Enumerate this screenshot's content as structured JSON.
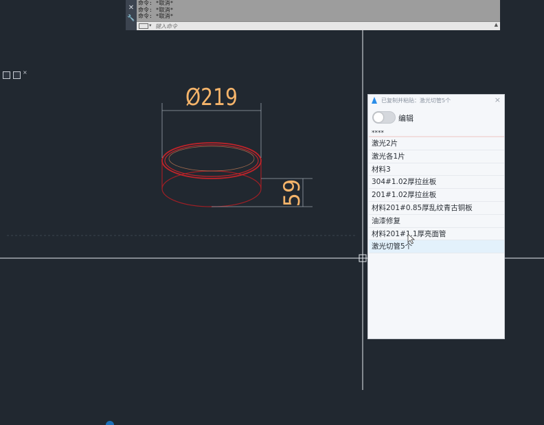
{
  "command_line": {
    "history": [
      "命令: *取消*",
      "命令: *取消*",
      "命令: *取消*"
    ],
    "input_placeholder": "键入命令",
    "side_buttons": [
      "✕",
      "🔧"
    ]
  },
  "drawing": {
    "diameter_label": "Ø219",
    "height_label": "59",
    "colors": {
      "background": "#212830",
      "dimension": "#f5b46a",
      "object": "#c0242a",
      "extension_lines": "#9aa3ad",
      "crosshair": "#e8ebef"
    }
  },
  "clipboard_panel": {
    "title": "已复制并粘贴：激光切管5个",
    "edit_label": "编辑",
    "toggle_on": false,
    "items": [
      "****",
      "激光2片",
      "激光各1片",
      "材料3",
      "304#1.02厚拉丝板",
      "201#1.02厚拉丝板",
      "材料201#0.85厚乱纹青古铜板",
      "油漆修复",
      "材料201#1.1厚亮面管",
      "激光切管5个"
    ],
    "selected_index": 9,
    "accent_color": "#2a8de8"
  }
}
